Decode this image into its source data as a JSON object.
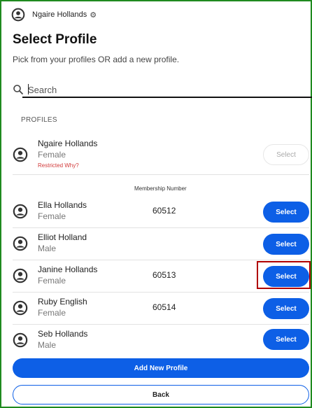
{
  "header": {
    "user_name": "Ngaire Hollands",
    "settings_icon": "gear-icon",
    "avatar_icon": "person-circle-icon"
  },
  "page": {
    "title": "Select Profile",
    "subtitle": "Pick from your profiles OR add a new profile."
  },
  "search": {
    "placeholder": "Search",
    "value": "",
    "icon": "search-icon"
  },
  "profiles_section": {
    "label": "PROFILES",
    "membership_header": "Membership Number",
    "primary": {
      "name": "Ngaire Hollands",
      "gender": "Female",
      "restricted_text": "Restricted Why?",
      "button_label": "Select",
      "button_enabled": false
    },
    "members": [
      {
        "name": "Ella Hollands",
        "gender": "Female",
        "membership": "60512",
        "button_label": "Select"
      },
      {
        "name": "Elliot Holland",
        "gender": "Male",
        "membership": "",
        "button_label": "Select"
      },
      {
        "name": "Janine Hollands",
        "gender": "Female",
        "membership": "60513",
        "button_label": "Select"
      },
      {
        "name": "Ruby English",
        "gender": "Female",
        "membership": "60514",
        "button_label": "Select"
      },
      {
        "name": "Seb Hollands",
        "gender": "Male",
        "membership": "",
        "button_label": "Select"
      }
    ]
  },
  "actions": {
    "add_label": "Add New Profile",
    "back_label": "Back"
  },
  "colors": {
    "primary": "#0d5fe6",
    "frame_border": "#1f8a1f",
    "highlight": "#b00000",
    "restricted": "#d23a3a"
  }
}
